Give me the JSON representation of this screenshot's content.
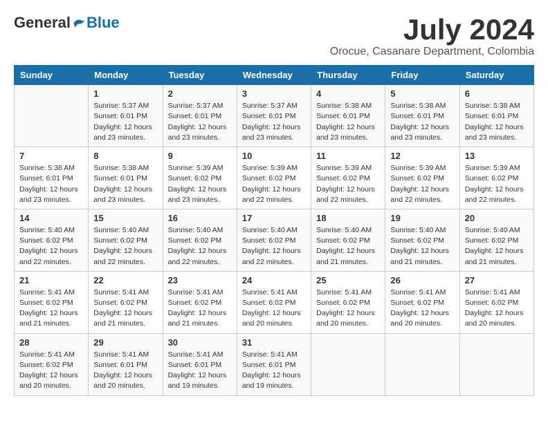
{
  "header": {
    "logo_general": "General",
    "logo_blue": "Blue",
    "month": "July 2024",
    "location": "Orocue, Casanare Department, Colombia"
  },
  "weekdays": [
    "Sunday",
    "Monday",
    "Tuesday",
    "Wednesday",
    "Thursday",
    "Friday",
    "Saturday"
  ],
  "weeks": [
    [
      {
        "day": "",
        "info": ""
      },
      {
        "day": "1",
        "info": "Sunrise: 5:37 AM\nSunset: 6:01 PM\nDaylight: 12 hours\nand 23 minutes."
      },
      {
        "day": "2",
        "info": "Sunrise: 5:37 AM\nSunset: 6:01 PM\nDaylight: 12 hours\nand 23 minutes."
      },
      {
        "day": "3",
        "info": "Sunrise: 5:37 AM\nSunset: 6:01 PM\nDaylight: 12 hours\nand 23 minutes."
      },
      {
        "day": "4",
        "info": "Sunrise: 5:38 AM\nSunset: 6:01 PM\nDaylight: 12 hours\nand 23 minutes."
      },
      {
        "day": "5",
        "info": "Sunrise: 5:38 AM\nSunset: 6:01 PM\nDaylight: 12 hours\nand 23 minutes."
      },
      {
        "day": "6",
        "info": "Sunrise: 5:38 AM\nSunset: 6:01 PM\nDaylight: 12 hours\nand 23 minutes."
      }
    ],
    [
      {
        "day": "7",
        "info": "Sunrise: 5:38 AM\nSunset: 6:01 PM\nDaylight: 12 hours\nand 23 minutes."
      },
      {
        "day": "8",
        "info": "Sunrise: 5:38 AM\nSunset: 6:01 PM\nDaylight: 12 hours\nand 23 minutes."
      },
      {
        "day": "9",
        "info": "Sunrise: 5:39 AM\nSunset: 6:02 PM\nDaylight: 12 hours\nand 23 minutes."
      },
      {
        "day": "10",
        "info": "Sunrise: 5:39 AM\nSunset: 6:02 PM\nDaylight: 12 hours\nand 22 minutes."
      },
      {
        "day": "11",
        "info": "Sunrise: 5:39 AM\nSunset: 6:02 PM\nDaylight: 12 hours\nand 22 minutes."
      },
      {
        "day": "12",
        "info": "Sunrise: 5:39 AM\nSunset: 6:02 PM\nDaylight: 12 hours\nand 22 minutes."
      },
      {
        "day": "13",
        "info": "Sunrise: 5:39 AM\nSunset: 6:02 PM\nDaylight: 12 hours\nand 22 minutes."
      }
    ],
    [
      {
        "day": "14",
        "info": "Sunrise: 5:40 AM\nSunset: 6:02 PM\nDaylight: 12 hours\nand 22 minutes."
      },
      {
        "day": "15",
        "info": "Sunrise: 5:40 AM\nSunset: 6:02 PM\nDaylight: 12 hours\nand 22 minutes."
      },
      {
        "day": "16",
        "info": "Sunrise: 5:40 AM\nSunset: 6:02 PM\nDaylight: 12 hours\nand 22 minutes."
      },
      {
        "day": "17",
        "info": "Sunrise: 5:40 AM\nSunset: 6:02 PM\nDaylight: 12 hours\nand 22 minutes."
      },
      {
        "day": "18",
        "info": "Sunrise: 5:40 AM\nSunset: 6:02 PM\nDaylight: 12 hours\nand 21 minutes."
      },
      {
        "day": "19",
        "info": "Sunrise: 5:40 AM\nSunset: 6:02 PM\nDaylight: 12 hours\nand 21 minutes."
      },
      {
        "day": "20",
        "info": "Sunrise: 5:40 AM\nSunset: 6:02 PM\nDaylight: 12 hours\nand 21 minutes."
      }
    ],
    [
      {
        "day": "21",
        "info": "Sunrise: 5:41 AM\nSunset: 6:02 PM\nDaylight: 12 hours\nand 21 minutes."
      },
      {
        "day": "22",
        "info": "Sunrise: 5:41 AM\nSunset: 6:02 PM\nDaylight: 12 hours\nand 21 minutes."
      },
      {
        "day": "23",
        "info": "Sunrise: 5:41 AM\nSunset: 6:02 PM\nDaylight: 12 hours\nand 21 minutes."
      },
      {
        "day": "24",
        "info": "Sunrise: 5:41 AM\nSunset: 6:02 PM\nDaylight: 12 hours\nand 20 minutes."
      },
      {
        "day": "25",
        "info": "Sunrise: 5:41 AM\nSunset: 6:02 PM\nDaylight: 12 hours\nand 20 minutes."
      },
      {
        "day": "26",
        "info": "Sunrise: 5:41 AM\nSunset: 6:02 PM\nDaylight: 12 hours\nand 20 minutes."
      },
      {
        "day": "27",
        "info": "Sunrise: 5:41 AM\nSunset: 6:02 PM\nDaylight: 12 hours\nand 20 minutes."
      }
    ],
    [
      {
        "day": "28",
        "info": "Sunrise: 5:41 AM\nSunset: 6:02 PM\nDaylight: 12 hours\nand 20 minutes."
      },
      {
        "day": "29",
        "info": "Sunrise: 5:41 AM\nSunset: 6:01 PM\nDaylight: 12 hours\nand 20 minutes."
      },
      {
        "day": "30",
        "info": "Sunrise: 5:41 AM\nSunset: 6:01 PM\nDaylight: 12 hours\nand 19 minutes."
      },
      {
        "day": "31",
        "info": "Sunrise: 5:41 AM\nSunset: 6:01 PM\nDaylight: 12 hours\nand 19 minutes."
      },
      {
        "day": "",
        "info": ""
      },
      {
        "day": "",
        "info": ""
      },
      {
        "day": "",
        "info": ""
      }
    ]
  ]
}
